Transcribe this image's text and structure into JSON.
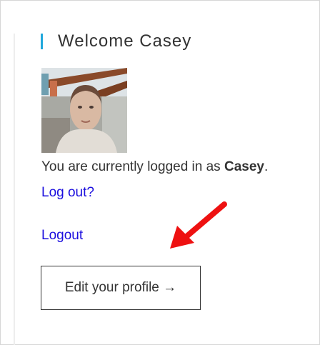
{
  "widget": {
    "title": "Welcome Casey",
    "status_prefix": "You are currently logged in as ",
    "username": "Casey",
    "status_suffix": ".",
    "logout_question_link": "Log out?",
    "logout_link": "Logout",
    "edit_profile_button": "Edit your profile →",
    "accent_color": "#21a8dc",
    "link_color": "#1a0dde"
  },
  "annotation": {
    "arrow_color": "#ee1111",
    "arrow_icon": "red-arrow-icon"
  }
}
